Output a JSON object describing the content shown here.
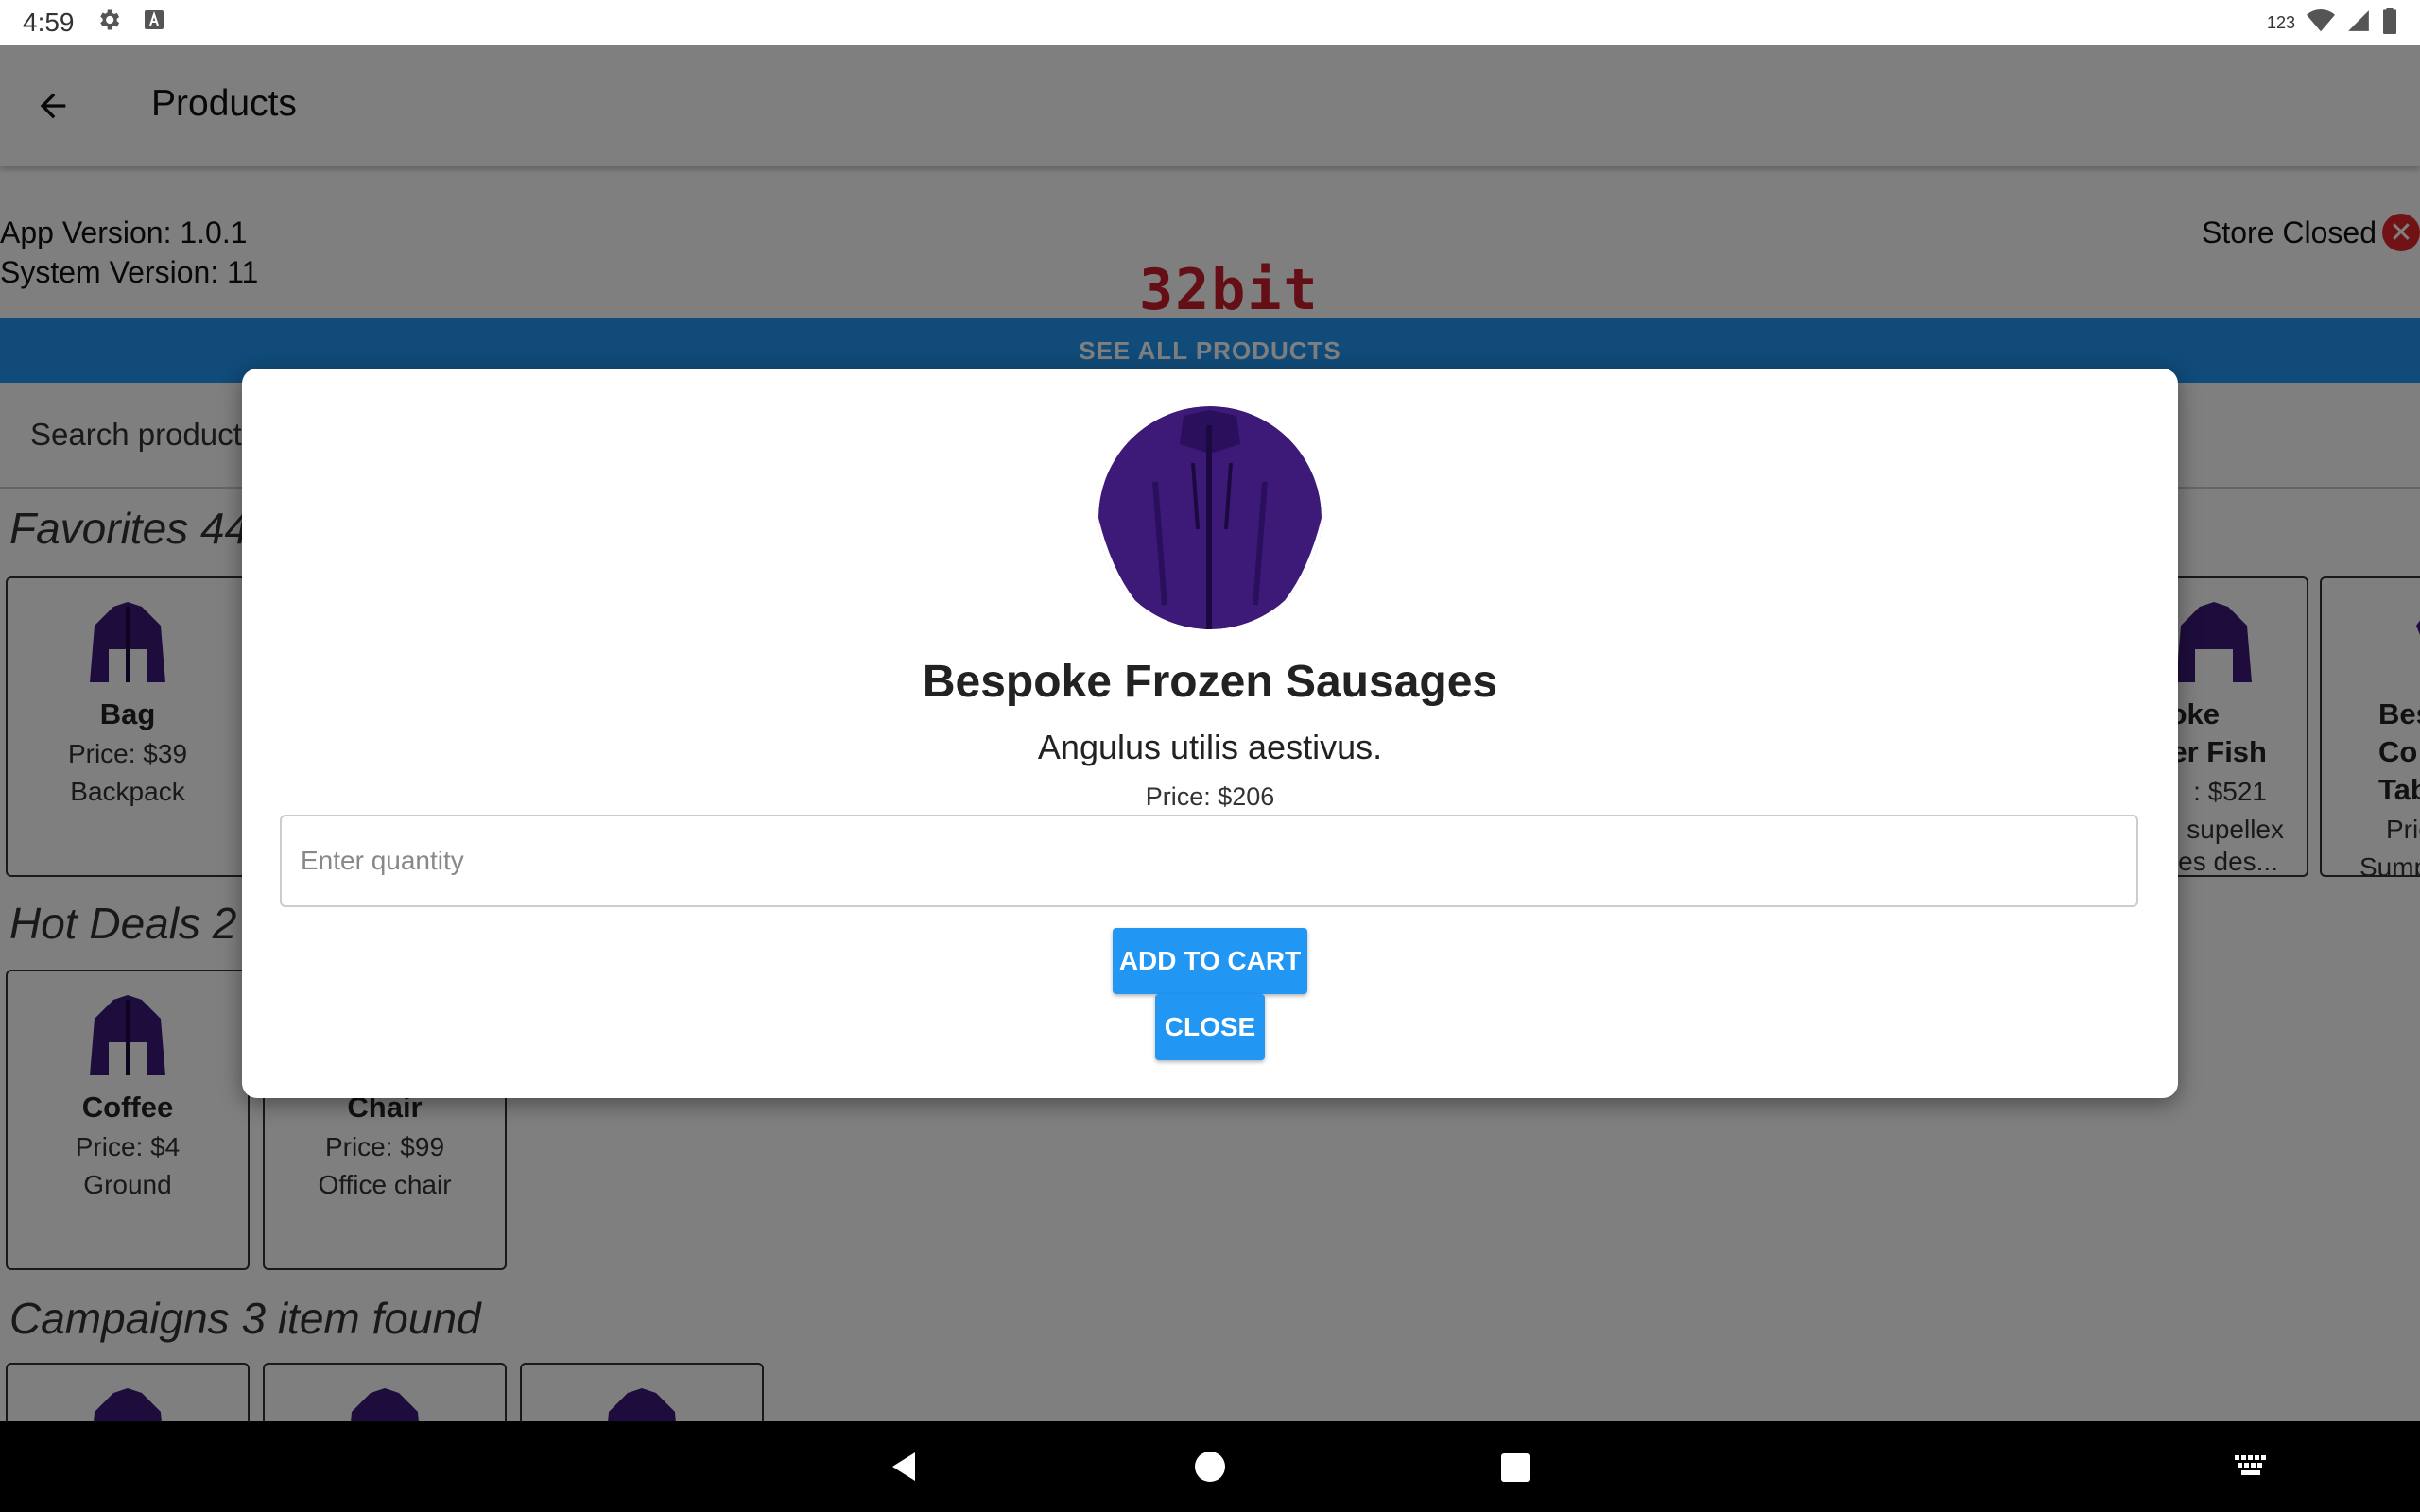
{
  "status_bar": {
    "time": "4:59",
    "right_text": "123"
  },
  "header": {
    "title": "Products"
  },
  "info": {
    "app_version": "App Version: 1.0.1",
    "system_version": "System Version: 11",
    "store_status": "Store Closed",
    "logo": "32bit"
  },
  "see_all_label": "SEE ALL PRODUCTS",
  "search": {
    "placeholder": "Search products"
  },
  "favorites": {
    "title": "Favorites 44",
    "cards": [
      {
        "name": "Bag",
        "price": "Price: $39",
        "desc": "Backpack"
      },
      {
        "name": "oke",
        "name2": "er Fish",
        "price": ": $521",
        "desc": "supellex",
        "desc2": "es des..."
      },
      {
        "name": "Bes",
        "name2": "Co",
        "name3": "Tab",
        "price": "Pric",
        "desc": "Sump"
      }
    ]
  },
  "hot_deals": {
    "title": "Hot Deals 2",
    "cards": [
      {
        "name": "Coffee",
        "price": "Price: $4",
        "desc": "Ground"
      },
      {
        "name": "Chair",
        "price": "Price: $99",
        "desc": "Office chair"
      }
    ]
  },
  "campaigns": {
    "title": "Campaigns 3 item found"
  },
  "modal": {
    "title": "Bespoke Frozen Sausages",
    "description": "Angulus utilis aestivus.",
    "price": "Price: $206",
    "quantity_placeholder": "Enter quantity",
    "add_label": "ADD TO CART",
    "close_label": "CLOSE"
  },
  "colors": {
    "accent": "#2196f3",
    "closed": "#e3262c",
    "jacket": "#3d1a78"
  }
}
